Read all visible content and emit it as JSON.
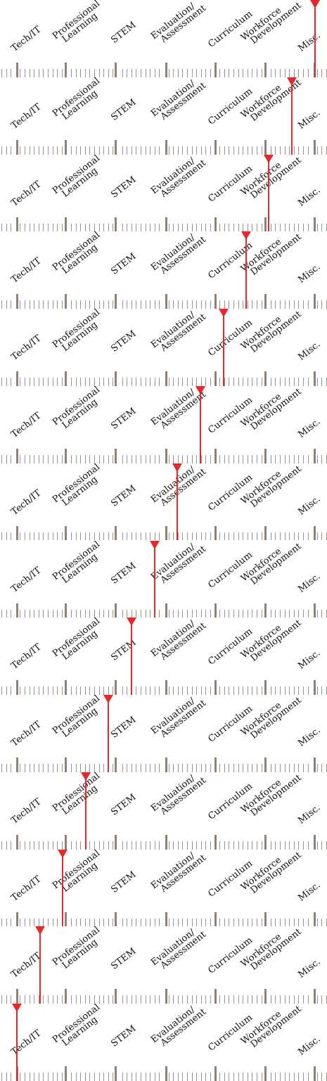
{
  "categories": [
    {
      "id": "tech-it",
      "lines": [
        "Tech/IT"
      ]
    },
    {
      "id": "professional-learning",
      "lines": [
        "Professional",
        "Learning"
      ]
    },
    {
      "id": "stem",
      "lines": [
        "STEM"
      ]
    },
    {
      "id": "evaluation-assessment",
      "lines": [
        "Evaluation/",
        "Assessment"
      ]
    },
    {
      "id": "curriculum",
      "lines": [
        "Curriculum"
      ]
    },
    {
      "id": "workforce-development",
      "lines": [
        "Workforce",
        "Development"
      ]
    },
    {
      "id": "misc",
      "lines": [
        "Misc."
      ]
    }
  ],
  "strip_count": 14,
  "colors": {
    "needle": "#e8262b",
    "tick": "#9e9389",
    "major_tick": "#8e8175",
    "text": "#111111"
  }
}
